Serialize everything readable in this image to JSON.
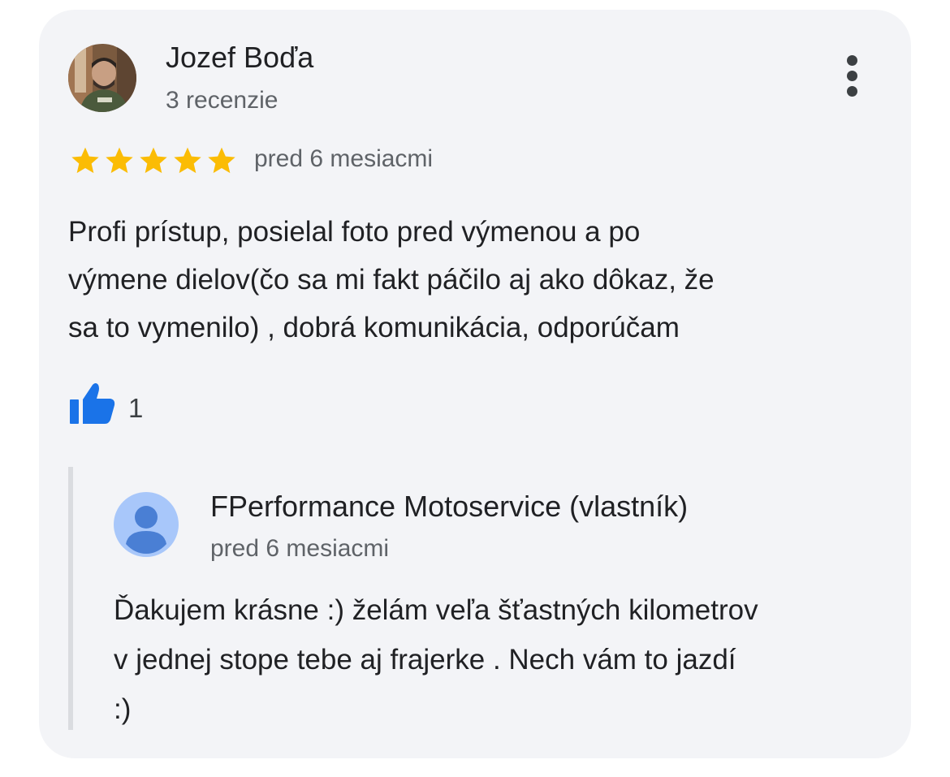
{
  "review": {
    "author_name": "Jozef Boďa",
    "author_meta": "3 recenzie",
    "rating": 5,
    "rating_max": 5,
    "date": "pred 6 mesiacmi",
    "text_lines": [
      "Profi prístup, posielal foto pred výmenou a po",
      "výmene dielov(čo sa mi fakt páčilo aj ako dôkaz, že",
      "sa to vymenilo) , dobrá komunikácia, odporúčam"
    ],
    "likes": "1",
    "menu_icon": "more-vert-icon",
    "like_icon": "thumbs-up-icon",
    "star_color": "#fbbc04",
    "like_color": "#1a73e8"
  },
  "owner_reply": {
    "name": "FPerformance Motoservice (vlastník)",
    "date": "pred 6 mesiacmi",
    "avatar_icon": "default-person-avatar-icon",
    "text_lines": [
      "Ďakujem krásne :) želám veľa šťastných kilometrov",
      "v jednej stope tebe aj frajerke . Nech vám to jazdí",
      ":)"
    ]
  }
}
